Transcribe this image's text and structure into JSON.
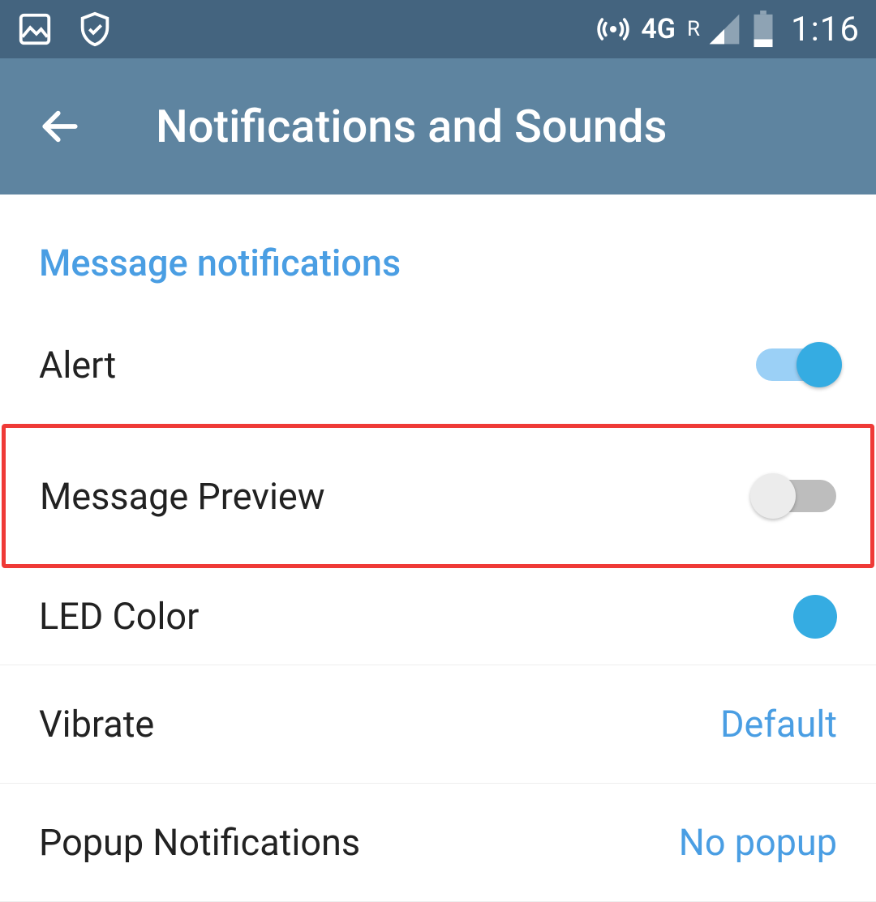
{
  "status_bar": {
    "network_label": "4G",
    "roaming_label": "R",
    "time": "1:16"
  },
  "app_bar": {
    "title": "Notifications and Sounds"
  },
  "section": {
    "header": "Message notifications",
    "items": {
      "alert": {
        "label": "Alert",
        "enabled": true
      },
      "message_preview": {
        "label": "Message Preview",
        "enabled": false
      },
      "led_color": {
        "label": "LED Color",
        "color": "#35ace2"
      },
      "vibrate": {
        "label": "Vibrate",
        "value": "Default"
      },
      "popup": {
        "label": "Popup Notifications",
        "value": "No popup"
      }
    }
  }
}
